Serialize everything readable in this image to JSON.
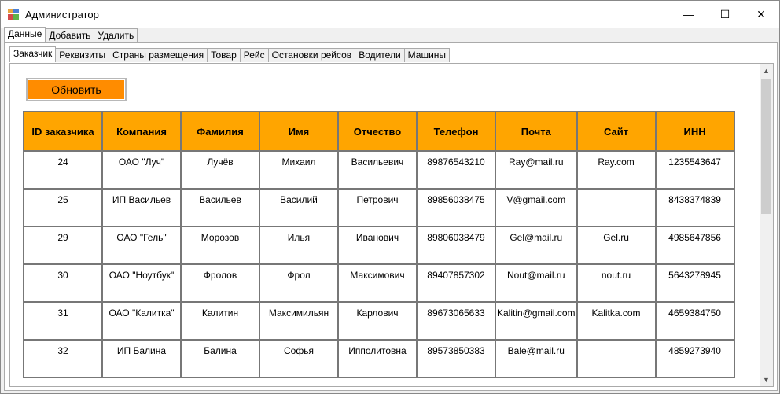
{
  "window": {
    "title": "Администратор"
  },
  "top_tabs": [
    {
      "label": "Данные",
      "active": true
    },
    {
      "label": "Добавить",
      "active": false
    },
    {
      "label": "Удалить",
      "active": false
    }
  ],
  "sub_tabs": [
    {
      "label": "Заказчик",
      "active": true
    },
    {
      "label": "Реквизиты",
      "active": false
    },
    {
      "label": "Страны размещения",
      "active": false
    },
    {
      "label": "Товар",
      "active": false
    },
    {
      "label": "Рейс",
      "active": false
    },
    {
      "label": "Остановки рейсов",
      "active": false
    },
    {
      "label": "Водители",
      "active": false
    },
    {
      "label": "Машины",
      "active": false
    }
  ],
  "refresh_button": {
    "label": "Обновить",
    "color": "#ff8c00"
  },
  "table": {
    "header_color": "#ffa500",
    "columns": [
      "ID заказчика",
      "Компания",
      "Фамилия",
      "Имя",
      "Отчество",
      "Телефон",
      "Почта",
      "Сайт",
      "ИНН"
    ],
    "rows": [
      [
        "24",
        "ОАО \"Луч\"",
        "Лучёв",
        "Михаил",
        "Васильевич",
        "89876543210",
        "Ray@mail.ru",
        "Ray.com",
        "1235543647"
      ],
      [
        "25",
        "ИП Васильев",
        "Васильев",
        "Василий",
        "Петрович",
        "89856038475",
        "V@gmail.com",
        "",
        "8438374839"
      ],
      [
        "29",
        "ОАО \"Гель\"",
        "Морозов",
        "Илья",
        "Иванович",
        "89806038479",
        "Gel@mail.ru",
        "Gel.ru",
        "4985647856"
      ],
      [
        "30",
        "ОАО \"Ноутбук\"",
        "Фролов",
        "Фрол",
        "Максимович",
        "89407857302",
        "Nout@mail.ru",
        "nout.ru",
        "5643278945"
      ],
      [
        "31",
        "ОАО \"Калитка\"",
        "Калитин",
        "Максимильян",
        "Карлович",
        "89673065633",
        "Kalitin@gmail.com",
        "Kalitka.com",
        "4659384750"
      ],
      [
        "32",
        "ИП Балина",
        "Балина",
        "Софья",
        "Ипполитовна",
        "89573850383",
        "Bale@mail.ru",
        "",
        "4859273940"
      ]
    ]
  }
}
